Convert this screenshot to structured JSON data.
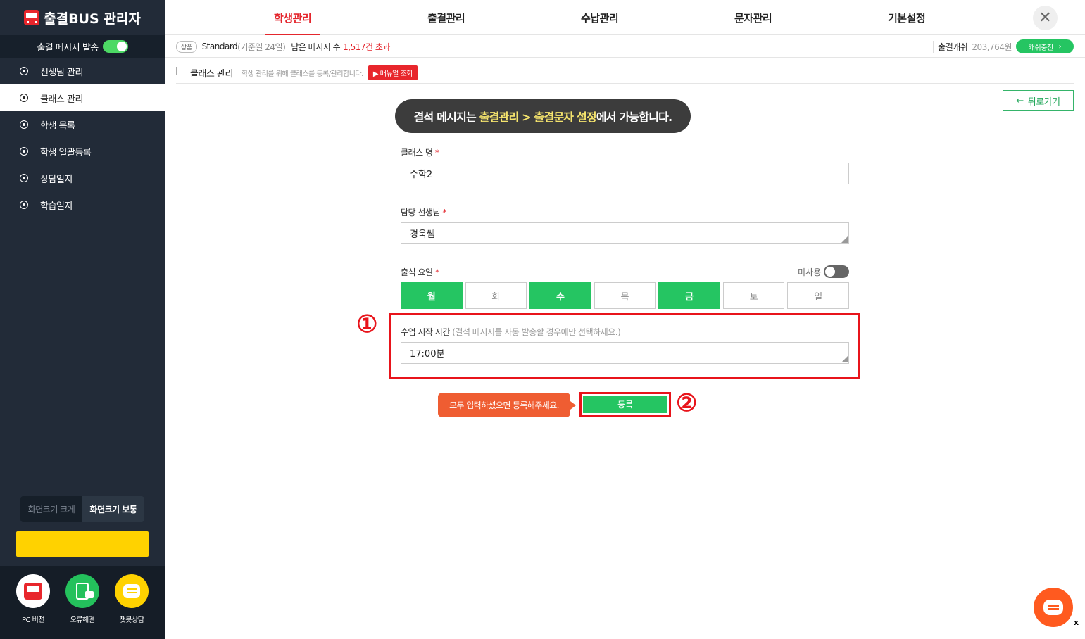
{
  "sidebar": {
    "title": "출결BUS 관리자",
    "msg_send_label": "출결 메시지 발송",
    "items": [
      {
        "label": "선생님 관리"
      },
      {
        "label": "클래스 관리"
      },
      {
        "label": "학생 목록"
      },
      {
        "label": "학생 일괄등록"
      },
      {
        "label": "상담일지"
      },
      {
        "label": "학습일지"
      }
    ],
    "size_large": "화면크기 크게",
    "size_normal": "화면크기 보통",
    "bottom": {
      "pc": "PC 버젼",
      "error": "오류해결",
      "chatbot": "챗봇상담"
    }
  },
  "nav": {
    "tabs": [
      {
        "label": "학생관리"
      },
      {
        "label": "출결관리"
      },
      {
        "label": "수납관리"
      },
      {
        "label": "문자관리"
      },
      {
        "label": "기본설정"
      }
    ],
    "close": "✕"
  },
  "info": {
    "product_badge": "상품",
    "plan": "Standard",
    "plan_sub": "(기준일 24일)",
    "remain_label": "남은 메시지 수",
    "remain_value": "1,517건 초과",
    "cash_label": "출결캐쉬",
    "cash_value": "203,764원",
    "charge": "캐쉬충전",
    "charge_arrow": "›"
  },
  "crumb": {
    "title": "클래스 관리",
    "desc": "학생 관리를 위해 클래스를 등록/관리합니다.",
    "manual": "▶ 매뉴얼 조회"
  },
  "back": {
    "arrow": "←",
    "label": "뒤로가기"
  },
  "notice": {
    "pre": "결석 메시지는 ",
    "highlight": "출결관리 > 출결문자 설정",
    "post": "에서 가능합니다."
  },
  "form": {
    "class_name_label": "클래스 명",
    "class_name_value": "수학2",
    "teacher_label": "담당 선생님",
    "teacher_value": "경욱쌤",
    "days_label": "출석 요일",
    "unused_label": "미사용",
    "days": [
      {
        "label": "월",
        "on": true
      },
      {
        "label": "화",
        "on": false
      },
      {
        "label": "수",
        "on": true
      },
      {
        "label": "목",
        "on": false
      },
      {
        "label": "금",
        "on": true
      },
      {
        "label": "토",
        "on": false
      },
      {
        "label": "일",
        "on": false
      }
    ],
    "start_label": "수업 시작 시간",
    "start_hint": "(결석 메시지를 자동 발송할 경우에만 선택하세요.)",
    "start_value": "17:00분",
    "required_mark": "*"
  },
  "tip": "모두 입력하셨으면 등록해주세요.",
  "register": "등록",
  "markers": {
    "one": "①",
    "two": "②"
  },
  "chat_close": "x"
}
